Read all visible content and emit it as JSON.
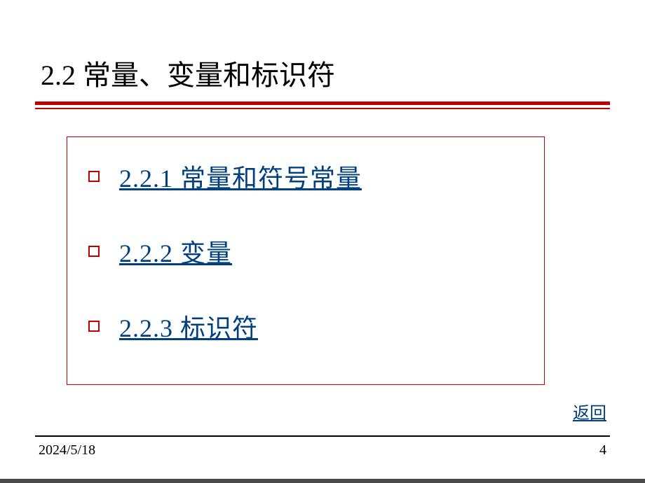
{
  "title": "2.2 常量、变量和标识符",
  "items": [
    {
      "label": "2.2.1 常量和符号常量"
    },
    {
      "label": "2.2.2 变量"
    },
    {
      "label": "2.2.3 标识符"
    }
  ],
  "back_label": "返回",
  "footer": {
    "date": "2024/5/18",
    "page": "4"
  }
}
